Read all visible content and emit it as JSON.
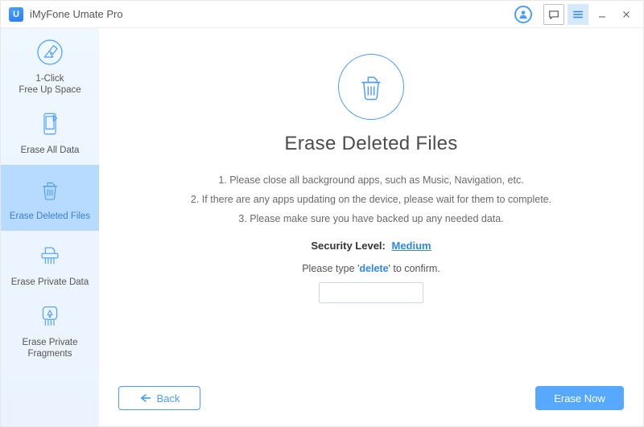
{
  "titlebar": {
    "app_name": "iMyFone Umate Pro",
    "logo_letter": "U"
  },
  "sidebar": {
    "items": [
      {
        "label": "1-Click\nFree Up Space"
      },
      {
        "label": "Erase All Data"
      },
      {
        "label": "Erase Deleted Files"
      },
      {
        "label": "Erase Private Data"
      },
      {
        "label": "Erase Private\nFragments"
      }
    ]
  },
  "main": {
    "title": "Erase Deleted Files",
    "instructions": [
      "1. Please close all background apps, such as Music, Navigation, etc.",
      "2. If there are any apps updating on the device, please wait for them to complete.",
      "3. Please make sure you have backed up any needed data."
    ],
    "security_label": "Security Level:",
    "security_value": "Medium",
    "confirm_prefix": "Please type '",
    "confirm_keyword": "delete",
    "confirm_suffix": "' to confirm.",
    "confirm_value": ""
  },
  "buttons": {
    "back": "Back",
    "erase_now": "Erase Now"
  }
}
